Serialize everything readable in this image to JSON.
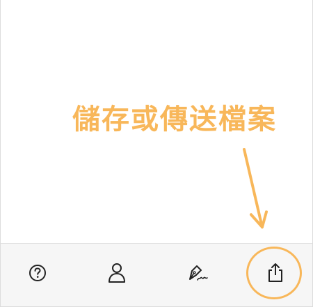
{
  "annotation": {
    "text": "儲存或傳送檔案",
    "color": "#f8b75a"
  },
  "toolbar": {
    "items": [
      {
        "name": "help",
        "icon": "help-circle-icon"
      },
      {
        "name": "contact",
        "icon": "person-icon"
      },
      {
        "name": "sign",
        "icon": "pen-signature-icon"
      },
      {
        "name": "share",
        "icon": "share-upload-icon"
      }
    ],
    "highlighted": "share"
  }
}
